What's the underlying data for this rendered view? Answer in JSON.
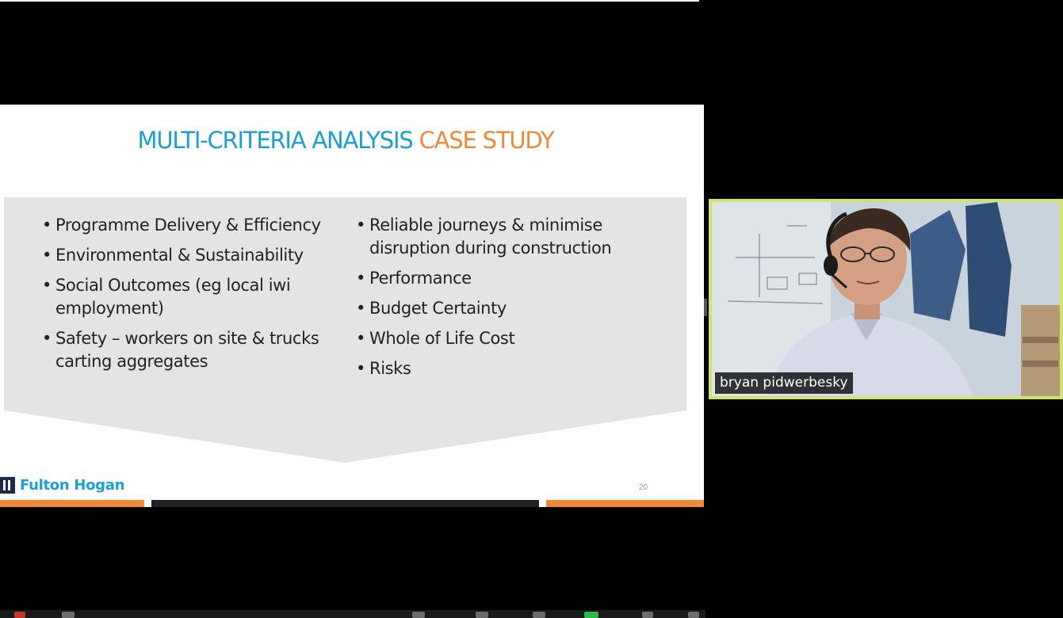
{
  "slide": {
    "title_part1": "MULTI-CRITERIA ANALYSIS",
    "title_part2": "CASE STUDY",
    "left_bullets": [
      "Programme Delivery & Efficiency",
      "Environmental & Sustainability",
      "Social Outcomes (eg local iwi employment)",
      "Safety – workers on site & trucks carting aggregates"
    ],
    "right_bullets": [
      "Reliable journeys & minimise disruption during construction",
      "Performance",
      "Budget Certainty",
      "Whole of Life Cost",
      "Risks"
    ],
    "logo_text": "Fulton Hogan",
    "page_number": "20"
  },
  "video": {
    "participant_name": "bryan pidwerbesky",
    "active_speaker_border": "#cfe36e"
  },
  "colors": {
    "title_blue": "#1a9fd0",
    "title_orange": "#f0883a",
    "panel_gray": "#e4e4e4"
  }
}
